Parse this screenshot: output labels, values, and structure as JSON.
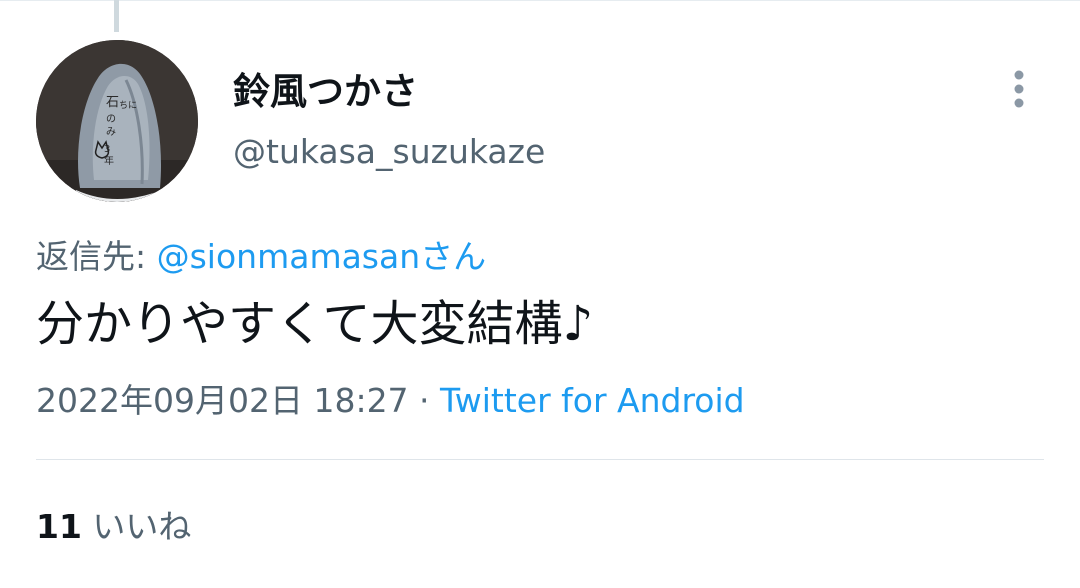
{
  "user": {
    "display_name": "鈴風つかさ",
    "handle": "@tukasa_suzukaze",
    "avatar_icon": "avatar-image-stone"
  },
  "more_icon": "more-vertical-icon",
  "reply": {
    "prefix": "返信先: ",
    "mention": "@sionmamasanさん"
  },
  "tweet": {
    "text": "分かりやすくて大変結構♪"
  },
  "meta": {
    "timestamp": "2022年09月02日 18:27",
    "separator": " · ",
    "source": "Twitter for Android"
  },
  "likes": {
    "count": "11",
    "label": " いいね"
  },
  "colors": {
    "text_primary": "#0f1419",
    "text_secondary": "#536471",
    "accent": "#1d9bf0",
    "border": "#e6ecf0"
  }
}
